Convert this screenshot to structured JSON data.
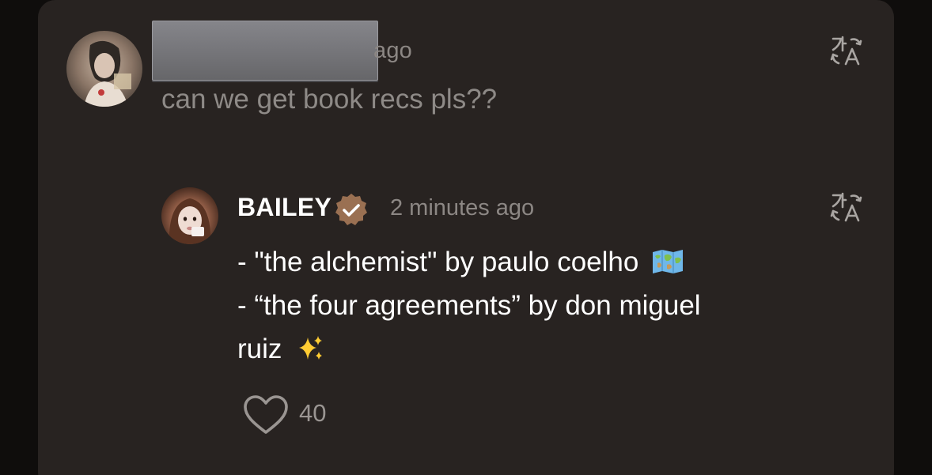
{
  "colors": {
    "card_bg": "#282321",
    "verified_badge": "#9a7052",
    "muted_text": "#8c8784",
    "primary_text": "#ffffff"
  },
  "comment": {
    "avatar_icon": "user-avatar",
    "time_suffix": "ago",
    "text": "can we get book recs pls??",
    "translate_icon": "translate-icon"
  },
  "reply": {
    "avatar_icon": "user-avatar",
    "author": "BAILEY",
    "verified_icon": "verified-badge-icon",
    "time": "2 minutes ago",
    "lines": [
      "- \"the alchemist\" by paulo coelho",
      "- “the four agreements” by don miguel",
      "ruiz"
    ],
    "emoji_1": "world-map-emoji",
    "emoji_2": "sparkles-emoji",
    "translate_icon": "translate-icon",
    "like_icon": "heart-icon",
    "like_count": "40"
  }
}
